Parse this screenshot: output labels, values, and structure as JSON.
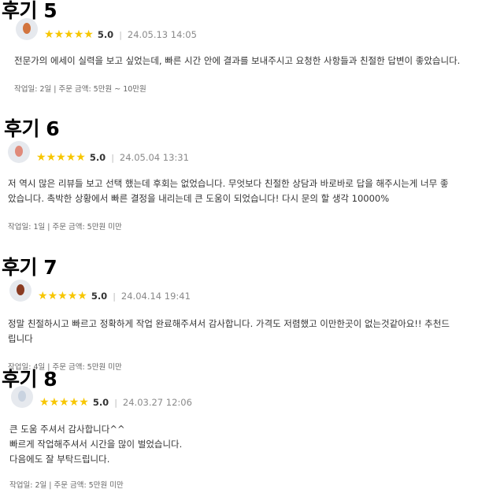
{
  "reviews": [
    {
      "heading": "후기 5",
      "score": "5.0",
      "date": "24.05.13 14:05",
      "avatar_color": "#d2743e",
      "body_lines": [
        "전문가의 에세이 실력을 보고 싶었는데, 빠른 시간 안에 결과를 보내주시고 요청한 사항들과 친절한 답변이 좋았습니다."
      ],
      "footer": "작업일: 2일 | 주문 금액: 5만원 ~ 10만원"
    },
    {
      "heading": "후기 6",
      "score": "5.0",
      "date": "24.05.04 13:31",
      "avatar_color": "#e08a7a",
      "body_lines": [
        "저 역시 많은 리뷰들 보고 선택 했는데 후회는 없었습니다. 무엇보다 친절한 상담과 바로바로 답을 해주시는게 너무 좋",
        "았습니다. 촉박한 상황에서 빠른 결정을 내리는데 큰 도움이 되었습니다! 다시 문의 할 생각 10000%"
      ],
      "footer": "작업일: 1일 | 주문 금액: 5만원 미만"
    },
    {
      "heading": "후기 7",
      "score": "5.0",
      "date": "24.04.14 19:41",
      "avatar_color": "#8a3b22",
      "body_lines": [
        "정말 친절하시고 빠르고 정확하게 작업 완료해주셔서 감사합니다. 가격도 저렴했고 이만한곳이 없는것같아요!! 추천드",
        "립니다"
      ],
      "footer": "작업일: 4일 | 주문 금액: 5만원 미만"
    },
    {
      "heading": "후기 8",
      "score": "5.0",
      "date": "24.03.27 12:06",
      "avatar_color": "#c9d3e0",
      "body_lines": [
        "큰 도움 주셔서 감사합니다^^",
        "빠르게 작업해주셔서 시간을 많이 벌었습니다.",
        "다음에도 잘 부탁드립니다."
      ],
      "footer": "작업일: 2일 | 주문 금액: 5만원 미만"
    }
  ]
}
